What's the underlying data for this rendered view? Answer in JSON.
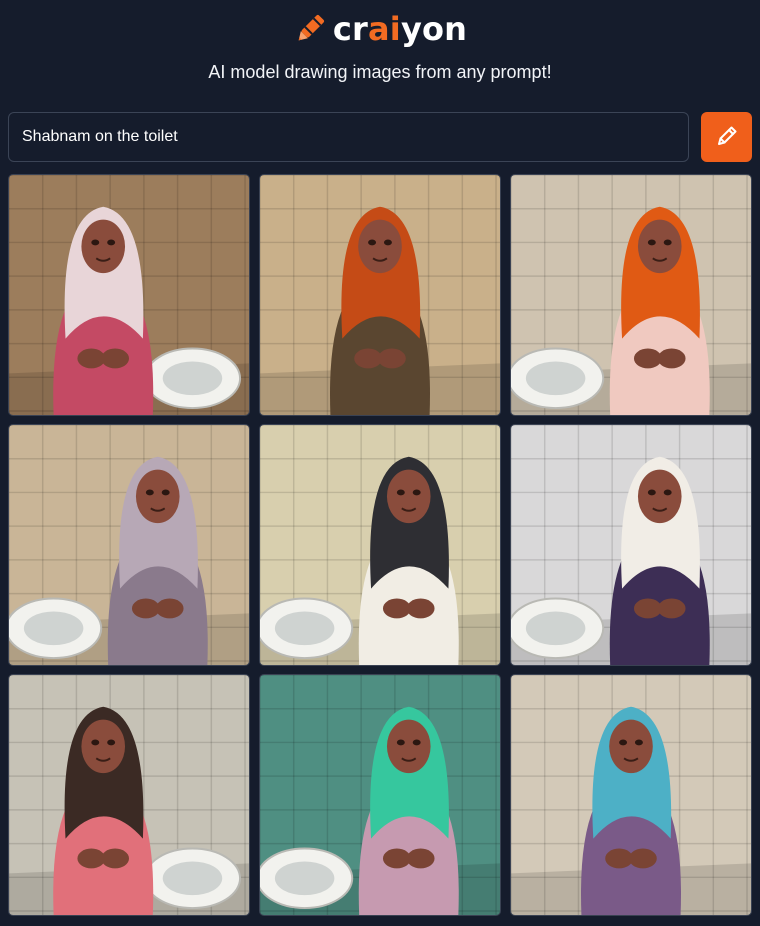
{
  "header": {
    "logo": {
      "prefix": "cr",
      "accent": "ai",
      "suffix": "yon",
      "icon": "crayon-pencil-icon"
    },
    "subtitle": "AI model drawing images from any prompt!"
  },
  "search": {
    "value": "Shabnam on the toilet",
    "button_icon": "pencil-icon"
  },
  "colors": {
    "background": "#151c2c",
    "accent": "#f05f1b",
    "input_border": "#3b4456"
  },
  "results": [
    {
      "wall": "#9c7d5c",
      "scarf": "#e8d5d8",
      "top": "#c44a64",
      "toilet": "right"
    },
    {
      "wall": "#c9b08a",
      "scarf": "#c54b16",
      "top": "#5a4630",
      "toilet": "center"
    },
    {
      "wall": "#cfc3b0",
      "scarf": "#e05a14",
      "top": "#f0c9c0",
      "toilet": "left"
    },
    {
      "wall": "#c9b597",
      "scarf": "#b7a8b6",
      "top": "#8a7a8c",
      "toilet": "left"
    },
    {
      "wall": "#d8cfae",
      "scarf": "#2e2e33",
      "top": "#f1ede4",
      "toilet": "left"
    },
    {
      "wall": "#d9d8d9",
      "scarf": "#f1ede6",
      "top": "#3d2e55",
      "toilet": "left"
    },
    {
      "wall": "#c6c2b6",
      "scarf": "#3b2a24",
      "top": "#e1707a",
      "toilet": "right"
    },
    {
      "wall": "#4f8f82",
      "scarf": "#36c79e",
      "top": "#c69ab0",
      "toilet": "left"
    },
    {
      "wall": "#d3c9b8",
      "scarf": "#4db0c6",
      "top": "#7a5a88",
      "toilet": "center"
    }
  ]
}
